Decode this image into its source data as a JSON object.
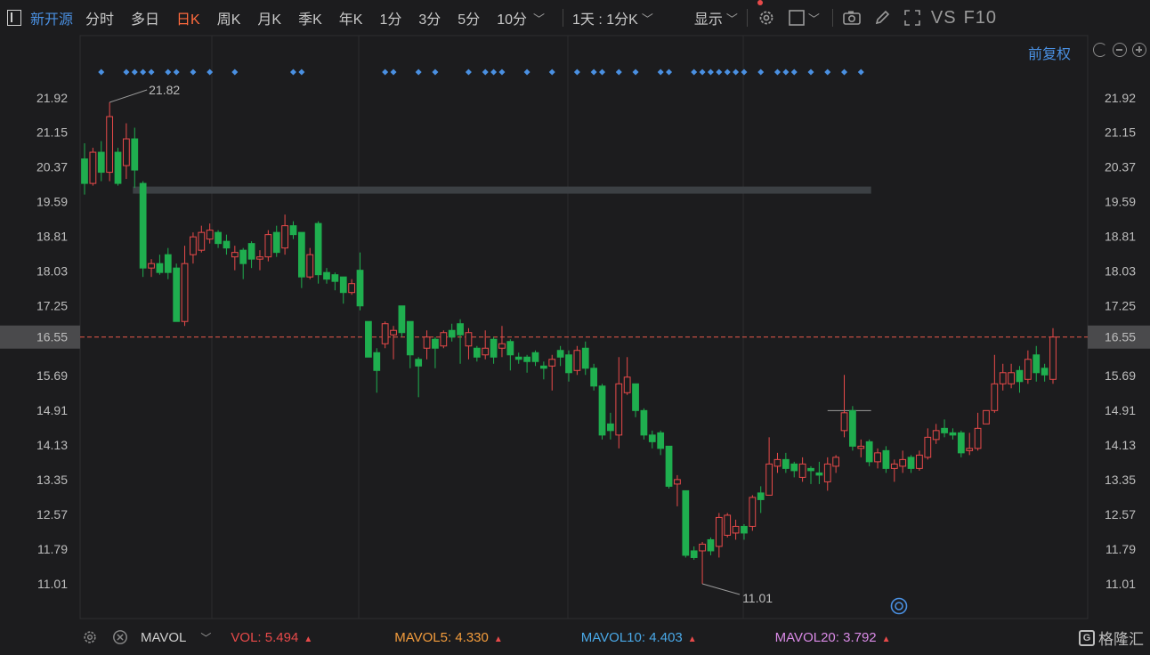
{
  "toolbar": {
    "stock_name": "新开源",
    "tabs": [
      "分时",
      "多日",
      "日K",
      "周K",
      "月K",
      "季K",
      "年K",
      "1分",
      "3分",
      "5分",
      "10分"
    ],
    "active_tab": "日K",
    "period_label": "1天 : 1分K",
    "display_label": "显示",
    "vs_label": "VS",
    "f10_label": "F10"
  },
  "adjust_label": "前复权",
  "colors": {
    "up": "#e84a4a",
    "down": "#1fae4f",
    "accent": "#4a90e2",
    "active_tab": "#ff6a3d",
    "current_price": "#e8584a",
    "mavol5": "#f39c3c",
    "mavol10": "#4aa9e8",
    "mavol20": "#d98ae6"
  },
  "icons": [
    "chart-toggle-icon",
    "settings-gear-icon",
    "square-icon",
    "camera-icon",
    "pencil-icon",
    "fullscreen-icon",
    "undo-icon",
    "zoom-out-icon",
    "zoom-in-icon",
    "q-marker-icon"
  ],
  "chart_data": {
    "type": "candlestick",
    "y_ticks": [
      "21.92",
      "21.15",
      "20.37",
      "19.59",
      "18.81",
      "18.03",
      "17.25",
      "16.55",
      "15.69",
      "14.91",
      "14.13",
      "13.35",
      "12.57",
      "11.79",
      "11.01"
    ],
    "ylim": [
      10.45,
      22.6
    ],
    "current_price": "16.55",
    "high_annotation": "21.82",
    "low_annotation": "11.01",
    "candles": [
      [
        20.55,
        20.0,
        20.9,
        19.75
      ],
      [
        20.0,
        20.7,
        20.8,
        19.95
      ],
      [
        20.7,
        20.25,
        20.95,
        20.05
      ],
      [
        20.25,
        21.5,
        21.82,
        20.05
      ],
      [
        20.7,
        20.0,
        20.8,
        19.95
      ],
      [
        20.4,
        21.0,
        21.35,
        20.1
      ],
      [
        21.0,
        20.3,
        21.25,
        19.9
      ],
      [
        20.0,
        18.1,
        20.05,
        17.9
      ],
      [
        18.1,
        18.2,
        18.3,
        17.9
      ],
      [
        18.2,
        18.0,
        18.4,
        17.95
      ],
      [
        18.4,
        18.0,
        18.55,
        17.85
      ],
      [
        18.1,
        16.9,
        18.2,
        16.9
      ],
      [
        16.9,
        18.2,
        18.6,
        16.8
      ],
      [
        18.4,
        18.8,
        18.9,
        18.2
      ],
      [
        18.5,
        18.9,
        19.05,
        18.45
      ],
      [
        18.75,
        18.95,
        19.1,
        18.65
      ],
      [
        18.9,
        18.65,
        18.95,
        18.55
      ],
      [
        18.7,
        18.55,
        18.85,
        18.4
      ],
      [
        18.35,
        18.45,
        18.6,
        18.05
      ],
      [
        18.5,
        18.2,
        18.55,
        17.85
      ],
      [
        18.65,
        18.3,
        18.7,
        18.1
      ],
      [
        18.3,
        18.35,
        18.5,
        18.05
      ],
      [
        18.35,
        18.85,
        18.95,
        18.25
      ],
      [
        18.9,
        18.45,
        19.05,
        18.35
      ],
      [
        18.55,
        19.05,
        19.3,
        18.4
      ],
      [
        19.05,
        18.85,
        19.15,
        18.75
      ],
      [
        18.9,
        17.9,
        18.9,
        17.65
      ],
      [
        17.9,
        18.4,
        18.55,
        17.85
      ],
      [
        19.1,
        17.95,
        19.15,
        17.75
      ],
      [
        18.0,
        17.85,
        18.1,
        17.75
      ],
      [
        17.95,
        17.8,
        18.0,
        17.6
      ],
      [
        17.9,
        17.55,
        17.9,
        17.3
      ],
      [
        17.55,
        17.75,
        17.85,
        17.5
      ],
      [
        18.05,
        17.25,
        18.45,
        17.15
      ],
      [
        16.9,
        16.1,
        16.9,
        16.1
      ],
      [
        16.2,
        15.8,
        16.3,
        15.3
      ],
      [
        16.4,
        16.85,
        16.9,
        16.3
      ],
      [
        16.6,
        16.7,
        16.8,
        16.05
      ],
      [
        17.25,
        16.65,
        17.25,
        16.55
      ],
      [
        16.9,
        16.15,
        16.9,
        15.85
      ],
      [
        16.05,
        15.9,
        16.1,
        15.2
      ],
      [
        16.3,
        16.55,
        16.7,
        16.05
      ],
      [
        16.5,
        16.3,
        16.55,
        15.85
      ],
      [
        16.35,
        16.65,
        16.7,
        16.3
      ],
      [
        16.7,
        16.55,
        16.85,
        16.45
      ],
      [
        16.85,
        16.6,
        16.95,
        15.95
      ],
      [
        16.35,
        16.65,
        16.75,
        16.05
      ],
      [
        16.3,
        16.1,
        16.35,
        16.0
      ],
      [
        16.15,
        16.3,
        16.7,
        16.05
      ],
      [
        16.5,
        16.1,
        16.55,
        15.95
      ],
      [
        16.3,
        16.4,
        16.8,
        16.1
      ],
      [
        16.45,
        16.15,
        16.5,
        15.8
      ],
      [
        16.1,
        16.05,
        16.2,
        15.95
      ],
      [
        16.1,
        16.0,
        16.15,
        15.75
      ],
      [
        16.2,
        16.0,
        16.25,
        15.9
      ],
      [
        15.9,
        15.85,
        16.0,
        15.6
      ],
      [
        15.9,
        16.05,
        16.15,
        15.35
      ],
      [
        16.25,
        16.1,
        16.35,
        15.9
      ],
      [
        16.15,
        15.75,
        16.25,
        15.55
      ],
      [
        15.8,
        16.25,
        16.35,
        15.7
      ],
      [
        16.3,
        15.85,
        16.45,
        15.7
      ],
      [
        15.85,
        15.45,
        15.95,
        15.35
      ],
      [
        15.45,
        14.35,
        15.5,
        14.25
      ],
      [
        14.6,
        14.45,
        14.85,
        14.25
      ],
      [
        14.35,
        15.5,
        16.1,
        14.05
      ],
      [
        15.3,
        15.65,
        16.1,
        15.25
      ],
      [
        15.5,
        14.9,
        15.5,
        14.75
      ],
      [
        14.9,
        14.35,
        14.95,
        14.25
      ],
      [
        14.35,
        14.2,
        14.45,
        14.05
      ],
      [
        14.4,
        14.05,
        14.45,
        13.9
      ],
      [
        14.1,
        13.2,
        14.1,
        13.15
      ],
      [
        13.25,
        13.35,
        13.45,
        12.75
      ],
      [
        13.1,
        11.65,
        13.1,
        11.6
      ],
      [
        11.75,
        11.6,
        11.85,
        11.55
      ],
      [
        11.75,
        11.9,
        11.95,
        11.01
      ],
      [
        12.0,
        11.75,
        12.05,
        11.65
      ],
      [
        11.85,
        12.5,
        12.6,
        11.6
      ],
      [
        12.1,
        12.55,
        12.6,
        12.05
      ],
      [
        12.15,
        12.3,
        12.45,
        12.0
      ],
      [
        12.3,
        12.15,
        12.35,
        12.0
      ],
      [
        12.3,
        12.95,
        13.0,
        12.2
      ],
      [
        13.05,
        12.9,
        13.2,
        12.6
      ],
      [
        13.0,
        13.7,
        14.3,
        13.0
      ],
      [
        13.65,
        13.8,
        13.95,
        13.5
      ],
      [
        13.8,
        13.6,
        13.95,
        13.5
      ],
      [
        13.7,
        13.55,
        13.75,
        13.4
      ],
      [
        13.4,
        13.7,
        13.85,
        13.3
      ],
      [
        13.6,
        13.55,
        13.65,
        13.25
      ],
      [
        13.5,
        13.45,
        13.75,
        13.25
      ],
      [
        13.3,
        13.7,
        13.85,
        13.1
      ],
      [
        13.65,
        13.85,
        13.9,
        13.5
      ],
      [
        14.45,
        14.85,
        15.7,
        14.3
      ],
      [
        14.9,
        14.1,
        15.0,
        14.0
      ],
      [
        14.05,
        14.1,
        14.25,
        13.85
      ],
      [
        14.2,
        13.75,
        14.25,
        13.65
      ],
      [
        13.75,
        13.95,
        14.05,
        13.6
      ],
      [
        14.0,
        13.6,
        14.1,
        13.5
      ],
      [
        13.6,
        13.7,
        13.8,
        13.3
      ],
      [
        13.65,
        13.8,
        14.0,
        13.5
      ],
      [
        13.85,
        13.6,
        13.9,
        13.5
      ],
      [
        13.6,
        13.9,
        14.0,
        13.55
      ],
      [
        13.85,
        14.3,
        14.5,
        13.8
      ],
      [
        14.25,
        14.45,
        14.6,
        14.15
      ],
      [
        14.5,
        14.4,
        14.7,
        14.3
      ],
      [
        14.4,
        14.35,
        14.5,
        14.25
      ],
      [
        14.4,
        13.95,
        14.45,
        13.85
      ],
      [
        14.0,
        14.05,
        14.4,
        13.9
      ],
      [
        14.05,
        14.5,
        14.85,
        14.0
      ],
      [
        14.6,
        14.9,
        14.9,
        14.6
      ],
      [
        14.9,
        15.5,
        16.15,
        14.85
      ],
      [
        15.5,
        15.75,
        15.95,
        15.35
      ],
      [
        15.5,
        15.75,
        15.95,
        15.4
      ],
      [
        15.8,
        15.55,
        15.9,
        15.3
      ],
      [
        15.6,
        16.05,
        16.25,
        15.5
      ],
      [
        16.15,
        15.75,
        16.35,
        15.55
      ],
      [
        15.85,
        15.7,
        15.95,
        15.55
      ],
      [
        15.6,
        16.55,
        16.75,
        15.5
      ]
    ],
    "signal_marker_indices": [
      2,
      5,
      6,
      7,
      8,
      10,
      11,
      13,
      15,
      18,
      25,
      26,
      36,
      37,
      40,
      42,
      46,
      48,
      49,
      50,
      53,
      56,
      59,
      61,
      62,
      64,
      66,
      69,
      70,
      73,
      74,
      75,
      76,
      77,
      78,
      79,
      81,
      83,
      84,
      85,
      87,
      89,
      91,
      93
    ],
    "support_line": {
      "value": 19.85,
      "start_index": 6,
      "end_index": 94
    },
    "support_line2": {
      "value": 14.9,
      "start_index": 89,
      "end_index": 94
    }
  },
  "indicators": {
    "name": "MAVOL",
    "vol": {
      "label": "VOL:",
      "value": "5.494"
    },
    "mavol5": {
      "label": "MAVOL5:",
      "value": "4.330"
    },
    "mavol10": {
      "label": "MAVOL10:",
      "value": "4.403"
    },
    "mavol20": {
      "label": "MAVOL20:",
      "value": "3.792"
    }
  },
  "logo_text": "格隆汇"
}
